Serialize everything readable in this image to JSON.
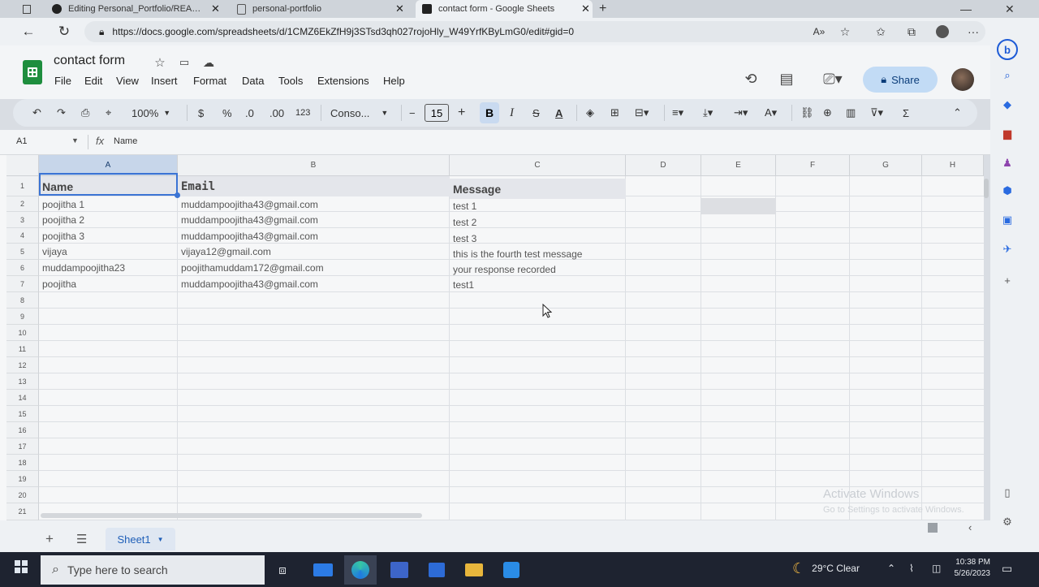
{
  "browser": {
    "tabs": [
      {
        "title": "Editing Personal_Portfolio/READM",
        "icon": "github-icon"
      },
      {
        "title": "personal-portfolio",
        "icon": "page-icon"
      },
      {
        "title": "contact form - Google Sheets",
        "icon": "sheets-icon",
        "active": true
      }
    ],
    "url": "https://docs.google.com/spreadsheets/d/1CMZ6EkZfH9j3STsd3qh027rojoHly_W49YrfKByLmG0/edit#gid=0"
  },
  "sheets": {
    "title": "contact form",
    "menus": [
      "File",
      "Edit",
      "View",
      "Insert",
      "Format",
      "Data",
      "Tools",
      "Extensions",
      "Help"
    ],
    "share_label": "Share",
    "toolbar": {
      "zoom": "100%",
      "currency": "$",
      "percent": "%",
      "dec_decrease": ".0",
      "dec_increase": ".00",
      "number_format": "123",
      "font": "Conso...",
      "minus": "−",
      "font_size": "15",
      "plus": "+",
      "bold": "B",
      "italic": "I",
      "strike": "S",
      "text_color": "A"
    },
    "formula_bar": {
      "cell_ref": "A1",
      "fx": "fx",
      "value": "Name"
    },
    "columns": [
      "A",
      "B",
      "C",
      "D",
      "E",
      "F",
      "G",
      "H"
    ],
    "row_numbers": [
      "1",
      "2",
      "3",
      "4",
      "5",
      "6",
      "7",
      "8",
      "9",
      "10",
      "11",
      "12",
      "13",
      "14",
      "15",
      "16",
      "17",
      "18",
      "19",
      "20",
      "21"
    ],
    "headers": [
      "Name",
      "Email",
      "Message"
    ],
    "rows": [
      [
        "poojitha 1",
        "muddampoojitha43@gmail.com",
        "test 1"
      ],
      [
        "poojitha 2",
        "muddampoojitha43@gmail.com",
        "test 2"
      ],
      [
        "poojitha 3",
        "muddampoojitha43@gmail.com",
        "test 3"
      ],
      [
        "vijaya",
        "vijaya12@gmail.com",
        "this is the fourth test message"
      ],
      [
        "muddampoojitha23",
        "poojithamuddam172@gmail.com",
        "your response recorded"
      ],
      [
        "poojitha",
        "muddampoojitha43@gmail.com",
        "test1"
      ]
    ],
    "sheet_tab": "Sheet1",
    "activate_windows": "Activate Windows",
    "activate_windows_sub": "Go to Settings to activate Windows."
  },
  "taskbar": {
    "search_placeholder": "Type here to search",
    "weather": "29°C  Clear",
    "time": "10:38 PM",
    "date": "5/26/2023"
  },
  "colors": {
    "sheets_green": "#1e8e3e",
    "selection_blue": "#3b74d4",
    "share_bg": "#c2dbf5",
    "taskbar": "#1e2330"
  }
}
